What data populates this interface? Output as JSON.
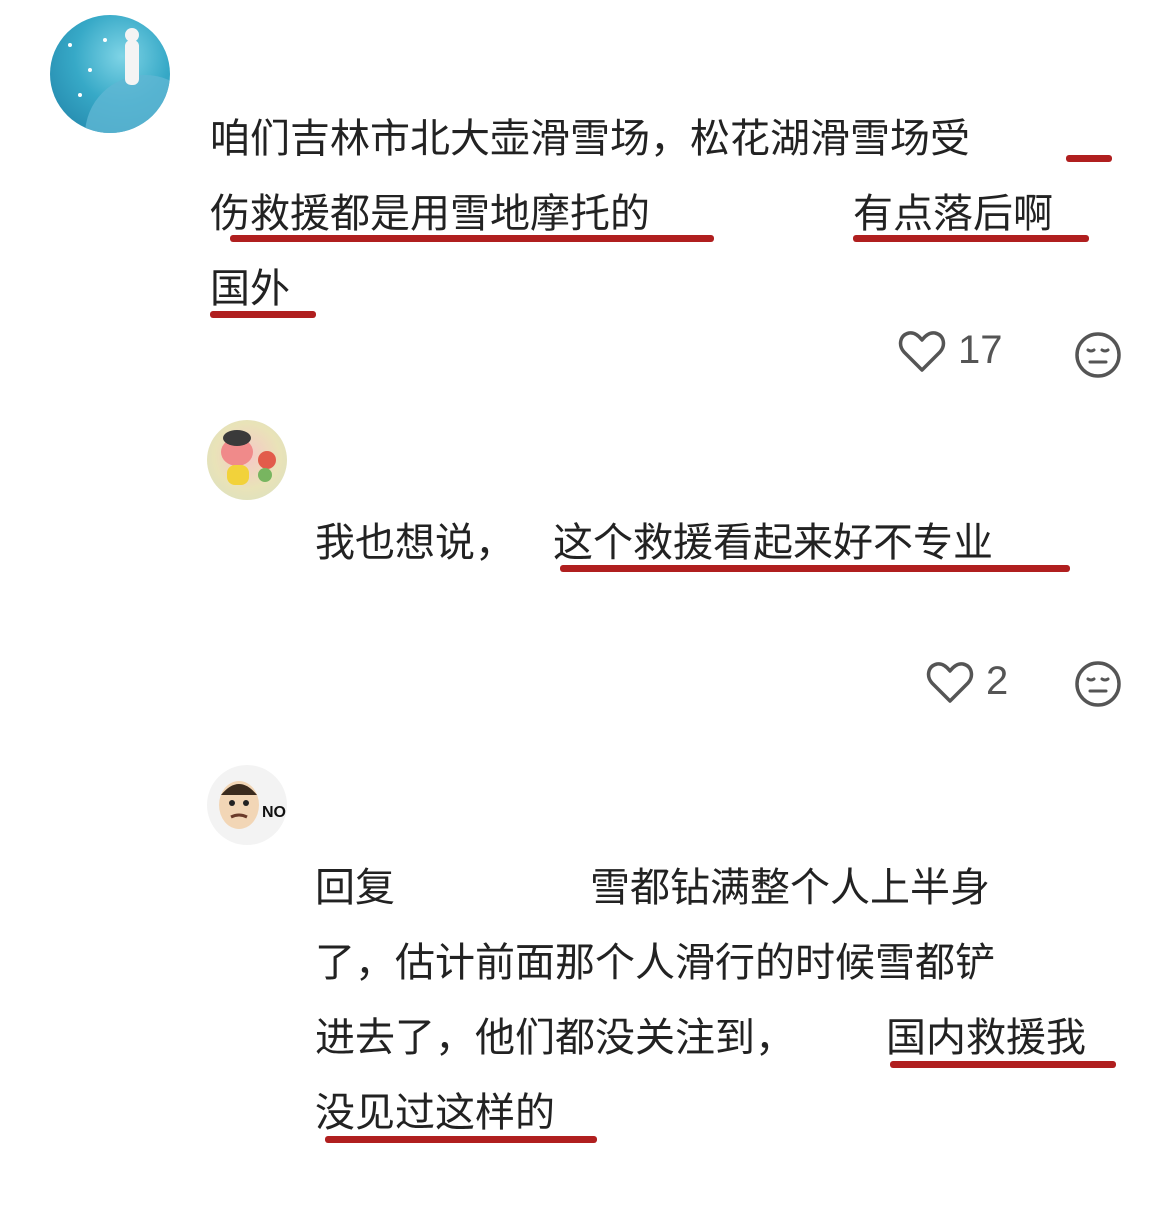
{
  "comments": [
    {
      "lines": [
        "咱们吉林市北大壶滑雪场，松花湖滑雪场受",
        "伤救援都是用雪地摩托的",
        "有点落后啊",
        "国外"
      ],
      "likes": "17",
      "like_icon": "heart-outline-icon",
      "reaction_icon": "neutral-face-icon"
    },
    {
      "text_a": "我也想说，",
      "text_b": "这个救援看起来好不专业",
      "likes": "2",
      "like_icon": "heart-outline-icon",
      "reaction_icon": "neutral-face-icon"
    },
    {
      "lines": [
        "回复",
        "雪都钻满整个人上半身",
        "了，估计前面那个人滑行的时候雪都铲",
        "进去了，他们都没关注到，",
        "国内救援我",
        "没见过这样的"
      ],
      "avatar_badge": "NO"
    }
  ],
  "colors": {
    "underline": "#b01f1f",
    "text": "#222222",
    "meta": "#555555"
  }
}
